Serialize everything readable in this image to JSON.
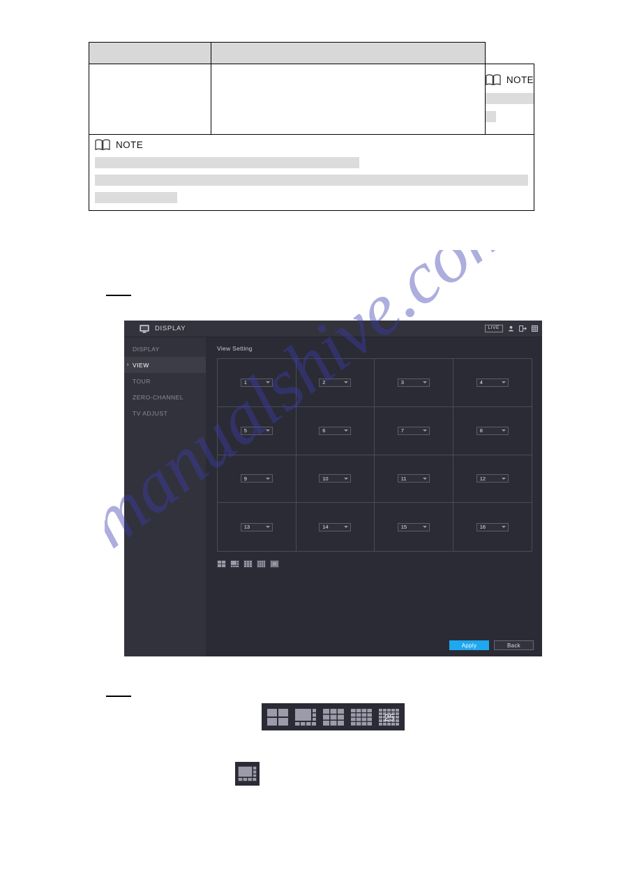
{
  "document": {
    "table": {
      "header_row": {
        "cells": [
          "",
          ""
        ]
      },
      "note_label": "NOTE",
      "inner_note_label": "NOTE"
    }
  },
  "dvr": {
    "title": "DISPLAY",
    "title_icon": "monitor-icon",
    "live_badge": "LIVE",
    "header_icons": [
      "user-icon",
      "logout-icon",
      "grid-icon"
    ],
    "sidebar": {
      "items": [
        {
          "label": "DISPLAY",
          "active": false
        },
        {
          "label": "VIEW",
          "active": true
        },
        {
          "label": "TOUR",
          "active": false
        },
        {
          "label": "ZERO-CHANNEL",
          "active": false
        },
        {
          "label": "TV ADJUST",
          "active": false
        }
      ]
    },
    "content": {
      "section_label": "View Setting",
      "grid": {
        "rows": 4,
        "cols": 4,
        "channels": [
          "1",
          "2",
          "3",
          "4",
          "5",
          "6",
          "7",
          "8",
          "9",
          "10",
          "11",
          "12",
          "13",
          "14",
          "15",
          "16"
        ]
      },
      "layout_options": [
        {
          "name": "split-4",
          "label": "4"
        },
        {
          "name": "split-6",
          "label": "6"
        },
        {
          "name": "split-9",
          "label": "9"
        },
        {
          "name": "split-16",
          "label": "16"
        },
        {
          "name": "split-25",
          "label": "25"
        }
      ]
    },
    "footer": {
      "apply_label": "Apply",
      "back_label": "Back"
    },
    "colors": {
      "accent": "#1da8f0",
      "panel_bg": "#2b2b35",
      "sidebar_bg": "#32323c",
      "title_bg": "#33333d",
      "grid_line": "#4b4b58"
    }
  },
  "enlarged_icons": {
    "row_1": [
      {
        "name": "split-4-icon",
        "label": ""
      },
      {
        "name": "split-6-icon",
        "label": ""
      },
      {
        "name": "split-9-icon",
        "label": ""
      },
      {
        "name": "split-16-icon",
        "label": ""
      },
      {
        "name": "split-25-icon",
        "label": "25"
      }
    ],
    "row_2": [
      {
        "name": "split-6-icon",
        "label": ""
      }
    ]
  },
  "watermark": {
    "text": "manualshive.com",
    "color": "#3b3bb0"
  }
}
